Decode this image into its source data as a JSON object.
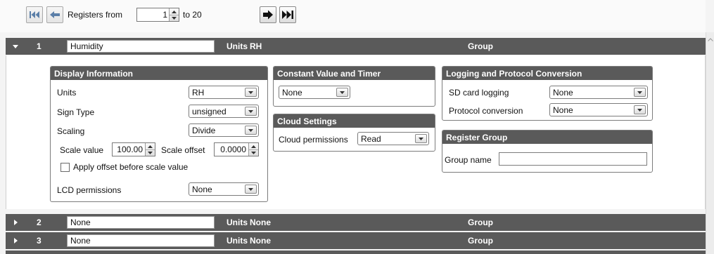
{
  "toolbar": {
    "registers_from_label": "Registers from",
    "from_value": "1",
    "to_label": "to 20",
    "buttons": [
      "first-page-icon",
      "prev-page-icon",
      "next-page-icon",
      "last-page-icon"
    ]
  },
  "registers": [
    {
      "num": "1",
      "name": "Humidity",
      "units_label": "Units",
      "units_value": "RH",
      "group_label": "Group",
      "expanded": true
    },
    {
      "num": "2",
      "name": "None",
      "units_label": "Units",
      "units_value": "None",
      "group_label": "Group",
      "expanded": false
    },
    {
      "num": "3",
      "name": "None",
      "units_label": "Units",
      "units_value": "None",
      "group_label": "Group",
      "expanded": false
    }
  ],
  "display_info": {
    "title": "Display Information",
    "units_label": "Units",
    "units_value": "RH",
    "sign_label": "Sign Type",
    "sign_value": "unsigned",
    "scaling_label": "Scaling",
    "scaling_value": "Divide",
    "scale_value_label": "Scale value",
    "scale_value": "100.00",
    "scale_offset_label": "Scale offset",
    "scale_offset": "0.0000",
    "apply_offset_label": "Apply offset before scale value",
    "apply_offset_checked": false,
    "lcd_label": "LCD permissions",
    "lcd_value": "None"
  },
  "constant_timer": {
    "title": "Constant Value and Timer",
    "value": "None"
  },
  "cloud": {
    "title": "Cloud Settings",
    "perm_label": "Cloud permissions",
    "perm_value": "Read"
  },
  "logging": {
    "title": "Logging and Protocol Conversion",
    "sd_label": "SD card logging",
    "sd_value": "None",
    "proto_label": "Protocol conversion",
    "proto_value": "None"
  },
  "register_group": {
    "title": "Register Group",
    "name_label": "Group name",
    "name_value": ""
  },
  "colors": {
    "bar": "#5a5a5a",
    "bar_text": "#ffffff",
    "arrow": "#111111"
  }
}
